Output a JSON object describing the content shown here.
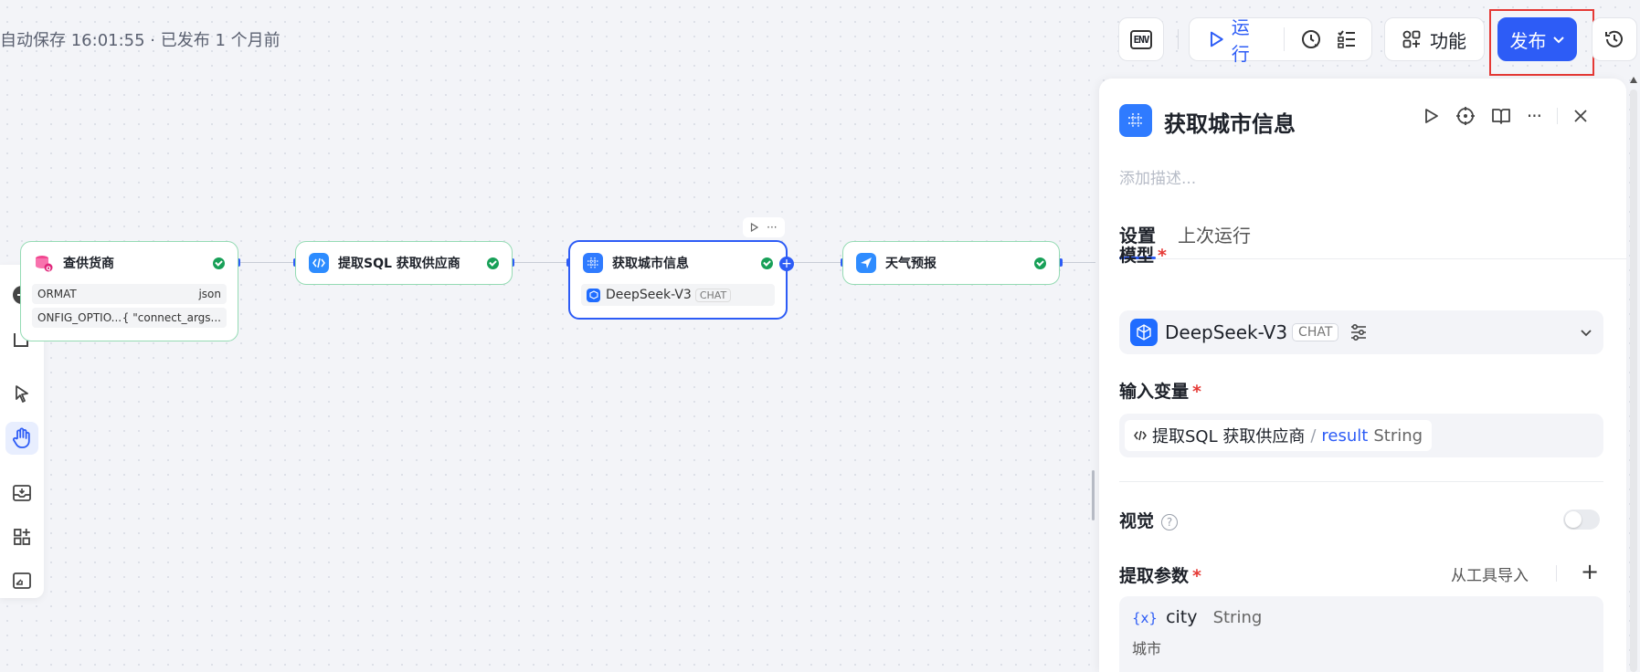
{
  "header": {
    "status": "自动保存 16:01:55 · 已发布 1 个月前",
    "env_label": "ENV",
    "run_label": "运行",
    "features_label": "功能",
    "publish_label": "发布"
  },
  "canvas": {
    "nodes": [
      {
        "title": "查供货商",
        "rows": [
          {
            "key": "ORMAT",
            "value": "json"
          },
          {
            "key": "ONFIG_OPTIO...",
            "value": "{ \"connect_args..."
          }
        ]
      },
      {
        "title": "提取SQL 获取供应商"
      },
      {
        "title": "获取城市信息",
        "model": "DeepSeek-V3",
        "model_tag": "CHAT"
      },
      {
        "title": "天气预报"
      }
    ]
  },
  "panel": {
    "title": "获取城市信息",
    "description_placeholder": "添加描述...",
    "tabs": [
      "设置",
      "上次运行"
    ],
    "model_label": "模型",
    "model_name": "DeepSeek-V3",
    "model_tag": "CHAT",
    "input_label": "输入变量",
    "input_chip": {
      "source": "提取SQL 获取供应商",
      "separator": "/",
      "var": "result",
      "type": "String"
    },
    "vision_label": "视觉",
    "params_label": "提取参数",
    "import_label": "从工具导入",
    "param": {
      "var_icon": "{x}",
      "name": "city",
      "type": "String",
      "description": "城市"
    }
  },
  "colors": {
    "accent": "#2d5cf6",
    "success": "#18a058",
    "highlight": "#e53935"
  }
}
